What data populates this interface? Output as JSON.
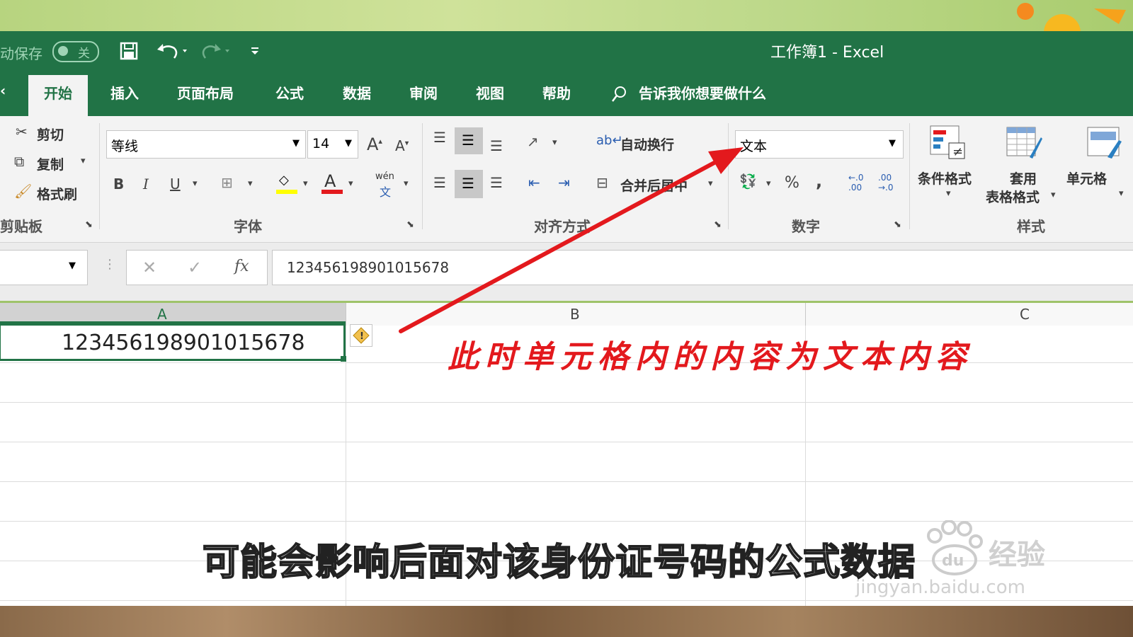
{
  "titlebar": {
    "autosave_label": "动保存",
    "autosave_state": "关",
    "title": "工作簿1  -  Excel"
  },
  "tabs": [
    {
      "label": "开始",
      "active": true
    },
    {
      "label": "插入"
    },
    {
      "label": "页面布局"
    },
    {
      "label": "公式"
    },
    {
      "label": "数据"
    },
    {
      "label": "审阅"
    },
    {
      "label": "视图"
    },
    {
      "label": "帮助"
    }
  ],
  "tell_me": "告诉我你想要做什么",
  "clipboard": {
    "cut": "剪切",
    "copy": "复制",
    "format_painter": "格式刷",
    "group": "剪贴板"
  },
  "font": {
    "name": "等线",
    "size": "14",
    "group": "字体",
    "bold": "B",
    "italic": "I",
    "underline": "U",
    "font_color_letter": "A",
    "phonetic_top": "wén",
    "phonetic_bottom": "文"
  },
  "alignment": {
    "wrap": "自动换行",
    "merge": "合并后居中",
    "group": "对齐方式"
  },
  "number": {
    "format": "文本",
    "group": "数字",
    "percent": "%",
    "comma": ",",
    "increase_decimal": "←.0 .00",
    "decrease_decimal": ".00 →.0"
  },
  "styles": {
    "conditional": "条件格式",
    "table_line1": "套用",
    "table_line2": "表格格式",
    "cell_styles": "单元格",
    "group": "样式"
  },
  "formula_bar": {
    "fx": "fx",
    "value": "123456198901015678"
  },
  "columns": [
    "A",
    "B",
    "C"
  ],
  "cell_a1": "123456198901015678",
  "annotation": "此时单元格内的内容为文本内容",
  "subtitle": "可能会影响后面对该身份证号码的公式数据",
  "watermark": {
    "brand": "经验",
    "url": "jingyan.baidu.com"
  },
  "colors": {
    "excel_green": "#217346",
    "annotation_red": "#e3191d"
  }
}
